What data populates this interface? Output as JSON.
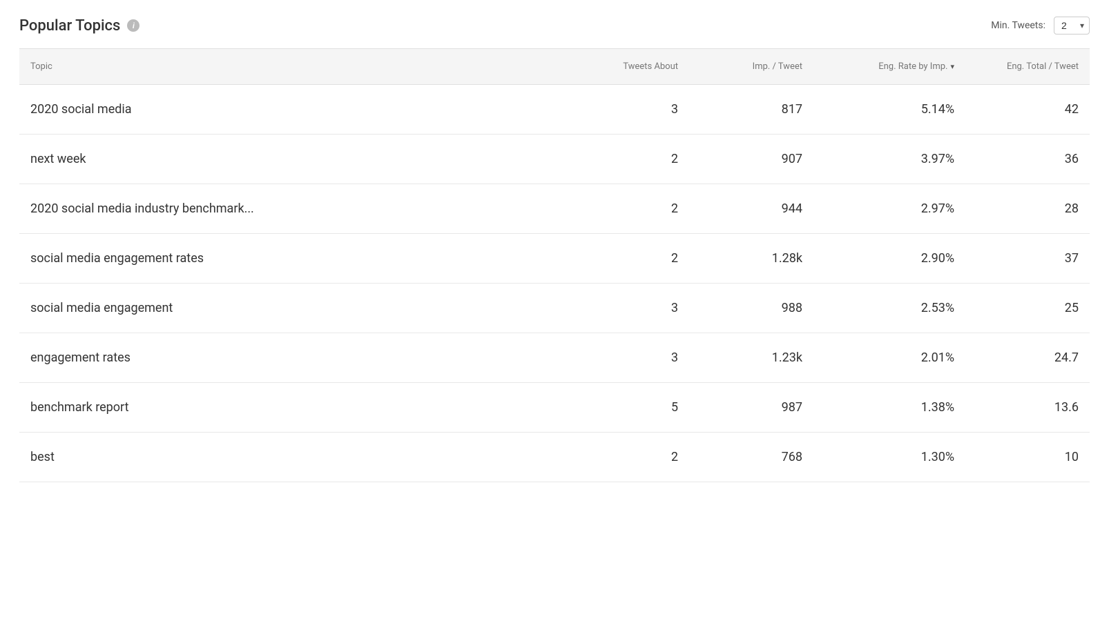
{
  "header": {
    "title": "Popular Topics",
    "info_icon_label": "i",
    "min_tweets_label": "Min. Tweets:",
    "min_tweets_value": "2"
  },
  "columns": [
    {
      "id": "topic",
      "label": "Topic",
      "align": "left",
      "sortable": false
    },
    {
      "id": "tweets_about",
      "label": "Tweets About",
      "align": "right",
      "sortable": false
    },
    {
      "id": "imp_per_tweet",
      "label": "Imp. / Tweet",
      "align": "right",
      "sortable": false
    },
    {
      "id": "eng_rate_by_imp",
      "label": "Eng. Rate by Imp.",
      "align": "right",
      "sortable": true
    },
    {
      "id": "eng_total_per_tweet",
      "label": "Eng. Total / Tweet",
      "align": "right",
      "sortable": false
    }
  ],
  "rows": [
    {
      "topic": "2020 social media",
      "tweets_about": "3",
      "imp_per_tweet": "817",
      "eng_rate_by_imp": "5.14%",
      "eng_total_per_tweet": "42"
    },
    {
      "topic": "next week",
      "tweets_about": "2",
      "imp_per_tweet": "907",
      "eng_rate_by_imp": "3.97%",
      "eng_total_per_tweet": "36"
    },
    {
      "topic": "2020 social media industry benchmark...",
      "tweets_about": "2",
      "imp_per_tweet": "944",
      "eng_rate_by_imp": "2.97%",
      "eng_total_per_tweet": "28"
    },
    {
      "topic": "social media engagement rates",
      "tweets_about": "2",
      "imp_per_tweet": "1.28k",
      "eng_rate_by_imp": "2.90%",
      "eng_total_per_tweet": "37"
    },
    {
      "topic": "social media engagement",
      "tweets_about": "3",
      "imp_per_tweet": "988",
      "eng_rate_by_imp": "2.53%",
      "eng_total_per_tweet": "25"
    },
    {
      "topic": "engagement rates",
      "tweets_about": "3",
      "imp_per_tweet": "1.23k",
      "eng_rate_by_imp": "2.01%",
      "eng_total_per_tweet": "24.7"
    },
    {
      "topic": "benchmark report",
      "tweets_about": "5",
      "imp_per_tweet": "987",
      "eng_rate_by_imp": "1.38%",
      "eng_total_per_tweet": "13.6"
    },
    {
      "topic": "best",
      "tweets_about": "2",
      "imp_per_tweet": "768",
      "eng_rate_by_imp": "1.30%",
      "eng_total_per_tweet": "10"
    }
  ]
}
